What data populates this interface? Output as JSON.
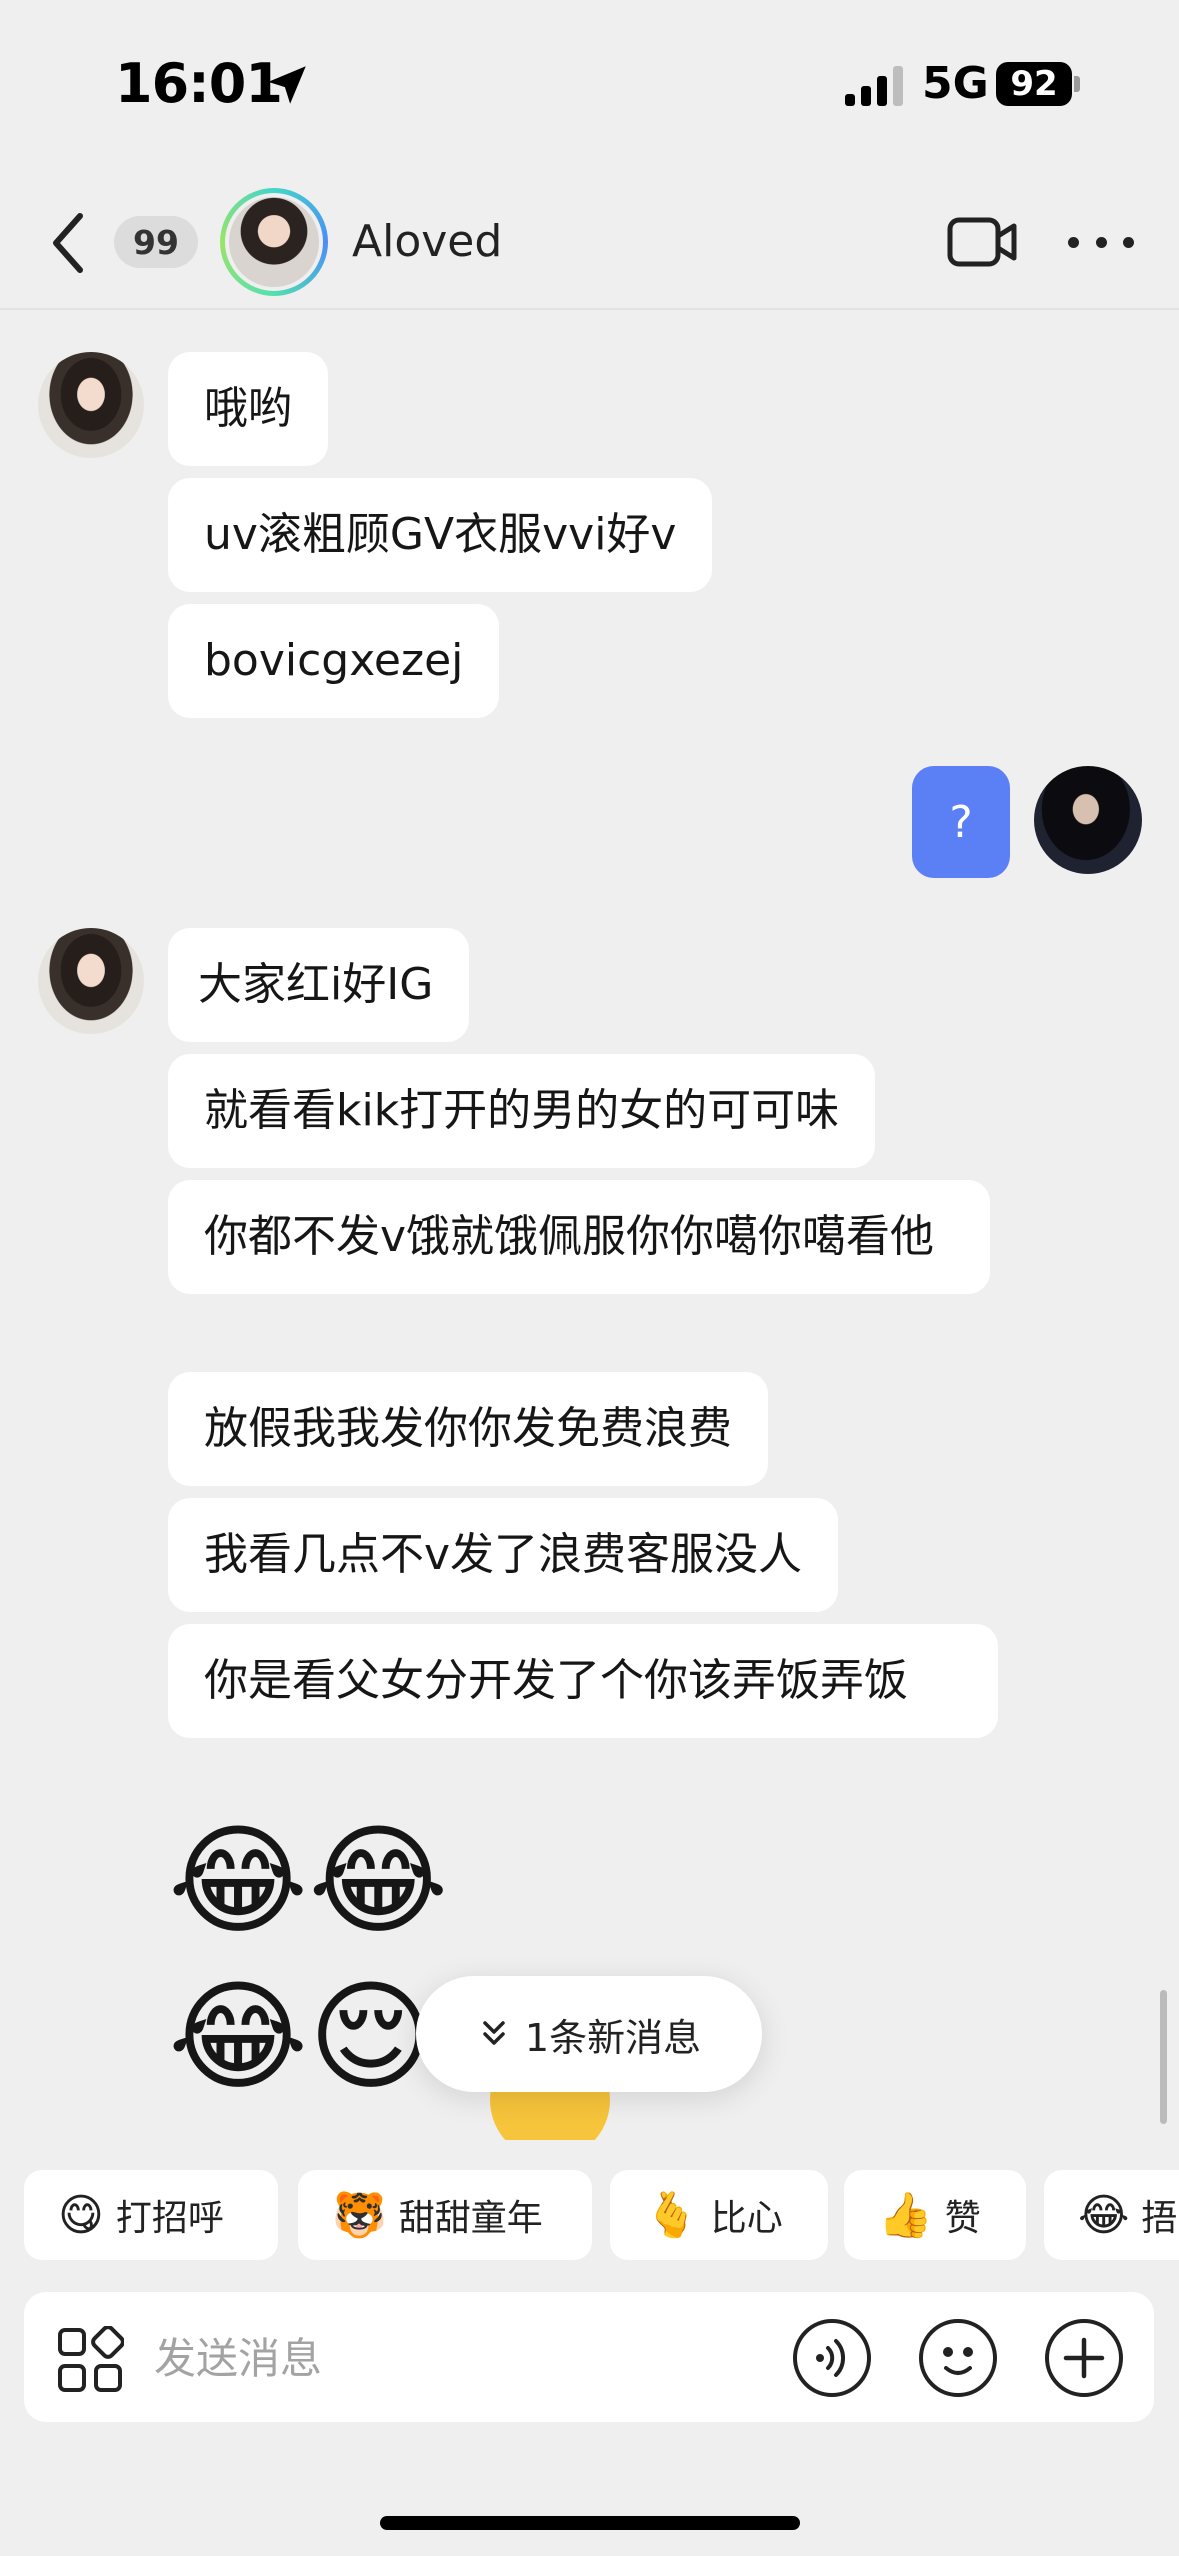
{
  "status_bar": {
    "time": "16:01",
    "network": "5G",
    "battery": "92"
  },
  "header": {
    "unread_count": "99",
    "contact_name": "Aloved"
  },
  "messages": {
    "group1": [
      "哦哟",
      "uv滚粗顾GV衣服vvi好v",
      "bovicgxezej"
    ],
    "sent": "?",
    "group2": [
      " 大家红i好IG",
      "就看看kik打开的男的女的可可味",
      "你都不发v饿就饿佩服你你噶你噶看他",
      "放假我我发你你发免费浪费",
      "我看几点不v发了浪费客服没人",
      "你是看父女分开发了个你该弄饭弄饭"
    ],
    "emoji_row1": "😂😂",
    "emoji_row2": "😂😌"
  },
  "new_messages_pill": "1条新消息",
  "quick_replies": [
    {
      "icon": "😋",
      "label": "打招呼"
    },
    {
      "icon": "🐯",
      "label": "甜甜童年"
    },
    {
      "icon": "🫰",
      "label": "比心"
    },
    {
      "icon": "👍",
      "label": "赞"
    },
    {
      "icon": "😂",
      "label": "捂"
    }
  ],
  "composer": {
    "placeholder": "发送消息"
  },
  "colors": {
    "sent_bubble": "#5b7ff5",
    "background": "#efefef",
    "avatar_ring": "#43d6c8"
  }
}
